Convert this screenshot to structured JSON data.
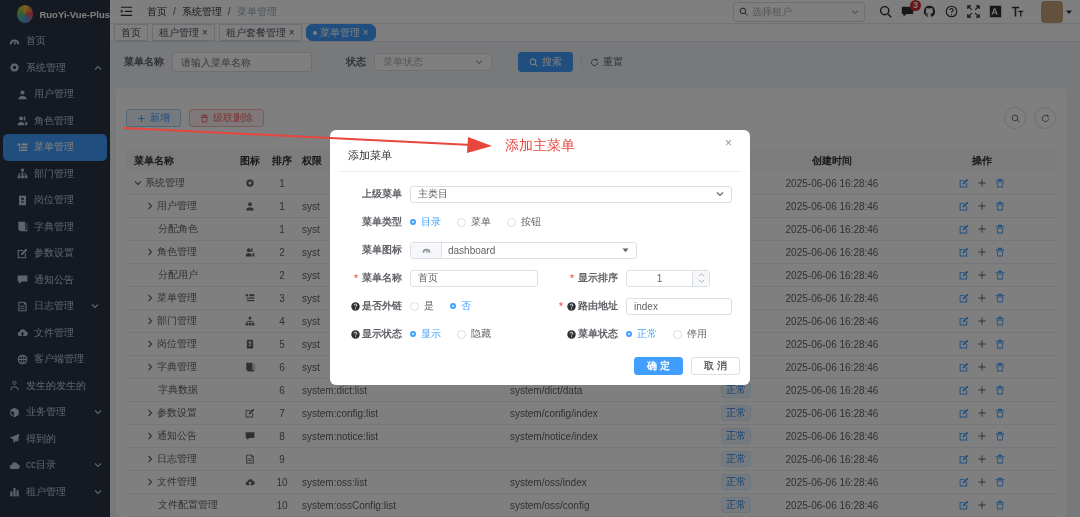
{
  "sidebar": {
    "logo_text": "RuoYi-Vue-Plus",
    "items": [
      {
        "label": "首页",
        "icon": {
          "kind": "dashboard"
        },
        "selected": false
      },
      {
        "label": "系统管理",
        "icon": {
          "kind": "gear"
        },
        "selected": false,
        "expanded": true,
        "children": [
          {
            "label": "用户管理",
            "icon": {
              "kind": "user"
            },
            "selected": false
          },
          {
            "label": "角色管理",
            "icon": {
              "kind": "users"
            },
            "selected": false
          },
          {
            "label": "菜单管理",
            "icon": {
              "kind": "menu"
            },
            "selected": true
          },
          {
            "label": "部门管理",
            "icon": {
              "kind": "tree"
            },
            "selected": false
          },
          {
            "label": "岗位管理",
            "icon": {
              "kind": "post"
            },
            "selected": false
          },
          {
            "label": "字典管理",
            "icon": {
              "kind": "dict"
            },
            "selected": false
          },
          {
            "label": "参数设置",
            "icon": {
              "kind": "edit"
            },
            "selected": false
          },
          {
            "label": "通知公告",
            "icon": {
              "kind": "message"
            },
            "selected": false
          },
          {
            "label": "日志管理",
            "icon": {
              "kind": "log"
            },
            "selected": false,
            "expanded": false
          },
          {
            "label": "文件管理",
            "icon": {
              "kind": "upload"
            },
            "selected": false
          },
          {
            "label": "客户端管理",
            "icon": {
              "kind": "client"
            },
            "selected": false
          }
        ]
      },
      {
        "label": "发生的发生的",
        "icon": {
          "kind": "person"
        },
        "selected": false
      },
      {
        "label": "业务管理",
        "icon": {
          "kind": "cube"
        },
        "selected": false,
        "expanded": false
      },
      {
        "label": "得到的",
        "icon": {
          "kind": "send"
        },
        "selected": false
      },
      {
        "label": "cc目录",
        "icon": {
          "kind": "cloud"
        },
        "selected": false,
        "expanded": false
      },
      {
        "label": "租户管理",
        "icon": {
          "kind": "chart"
        },
        "selected": false,
        "expanded": false
      }
    ]
  },
  "header": {
    "breadcrumb": [
      "首页",
      "系统管理",
      "菜单管理"
    ],
    "separator": "/",
    "tenant_select": {
      "placeholder": "选择租户"
    },
    "message_badge": "3"
  },
  "tabs": [
    {
      "label": "首页",
      "selected": false
    },
    {
      "label": "租户管理",
      "selected": false,
      "close": "×"
    },
    {
      "label": "租户套餐管理",
      "selected": false,
      "close": "×"
    },
    {
      "label": "菜单管理",
      "selected": true,
      "close": "×"
    }
  ],
  "search_form": {
    "name_label": "菜单名称",
    "name_placeholder": "请输入菜单名称",
    "status_label": "状态",
    "status_placeholder": "菜单状态",
    "search_button": "搜索",
    "reset_button": "重置"
  },
  "toolbar": {
    "buttons": [
      {
        "label": "新增",
        "kind": "primary"
      },
      {
        "label": "级联删除",
        "kind": "danger"
      }
    ]
  },
  "table": {
    "columns": [
      {
        "label": "菜单名称"
      },
      {
        "label": "图标"
      },
      {
        "label": "排序"
      },
      {
        "label": "权限"
      },
      {
        "label": "创建时间"
      },
      {
        "label": "操作"
      }
    ],
    "rows": [
      {
        "name": "系统管理",
        "kind": "folder",
        "expanded": true,
        "icon": {
          "kind": "gear"
        },
        "order": "1",
        "time": "2025-06-06 16:28:46",
        "children": [
          {
            "name": "用户管理",
            "kind": "folder",
            "expanded": false,
            "icon": {
              "kind": "user"
            },
            "order": "1",
            "perms": "syst",
            "time": "2025-06-06 16:28:46"
          },
          {
            "name": "分配角色",
            "kind": "leaf",
            "order": "1",
            "perms": "syst",
            "time": "2025-06-06 16:28:46"
          },
          {
            "name": "角色管理",
            "kind": "folder",
            "expanded": false,
            "icon": {
              "kind": "users"
            },
            "order": "2",
            "perms": "syst",
            "time": "2025-06-06 16:28:46"
          },
          {
            "name": "分配用户",
            "kind": "leaf",
            "order": "2",
            "perms": "syst",
            "time": "2025-06-06 16:28:46"
          },
          {
            "name": "菜单管理",
            "kind": "folder",
            "expanded": false,
            "icon": {
              "kind": "menu"
            },
            "order": "3",
            "perms": "syst",
            "time": "2025-06-06 16:28:46"
          },
          {
            "name": "部门管理",
            "kind": "folder",
            "expanded": false,
            "icon": {
              "kind": "tree"
            },
            "order": "4",
            "perms": "syst",
            "time": "2025-06-06 16:28:46"
          },
          {
            "name": "岗位管理",
            "kind": "folder",
            "expanded": false,
            "icon": {
              "kind": "post"
            },
            "order": "5",
            "perms": "syst",
            "time": "2025-06-06 16:28:46"
          },
          {
            "name": "字典管理",
            "kind": "folder",
            "expanded": false,
            "icon": {
              "kind": "dict"
            },
            "order": "6",
            "perms": "syst",
            "time": "2025-06-06 16:28:46"
          },
          {
            "name": "字典数据",
            "kind": "leaf",
            "order": "6",
            "perms": "system:dict:list",
            "path": "system/dict/data",
            "status": "正常",
            "time": "2025-06-06 16:28:46"
          },
          {
            "name": "参数设置",
            "kind": "folder",
            "expanded": false,
            "icon": {
              "kind": "edit"
            },
            "order": "7",
            "perms": "system:config:list",
            "path": "system/config/index",
            "status": "正常",
            "time": "2025-06-06 16:28:46"
          },
          {
            "name": "通知公告",
            "kind": "folder",
            "expanded": false,
            "icon": {
              "kind": "message"
            },
            "order": "8",
            "perms": "system:notice:list",
            "path": "system/notice/index",
            "status": "正常",
            "time": "2025-06-06 16:28:46"
          },
          {
            "name": "日志管理",
            "kind": "folder",
            "expanded": false,
            "icon": {
              "kind": "log"
            },
            "order": "9",
            "status": "正常",
            "time": "2025-06-06 16:28:46"
          },
          {
            "name": "文件管理",
            "kind": "folder",
            "expanded": false,
            "icon": {
              "kind": "upload"
            },
            "order": "10",
            "perms": "system:oss:list",
            "path": "system/oss/index",
            "status": "正常",
            "time": "2025-06-06 16:28:46"
          },
          {
            "name": "文件配置管理",
            "kind": "leaf",
            "order": "10",
            "perms": "system:ossConfig:list",
            "path": "system/oss/config",
            "status": "正常",
            "time": "2025-06-06 16:28:46"
          }
        ]
      }
    ]
  },
  "dialog": {
    "title": "添加菜单",
    "close": "×",
    "form": [
      [
        {
          "label": "上级菜单",
          "kind": "select",
          "value": "主类目",
          "help": false
        }
      ],
      [
        {
          "label": "菜单类型",
          "kind": "radio",
          "help": false,
          "options": [
            {
              "label": "目录",
              "selected": true
            },
            {
              "label": "菜单",
              "selected": false
            },
            {
              "label": "按钮",
              "selected": false
            }
          ]
        }
      ],
      [
        {
          "label": "菜单图标",
          "kind": "icon_select",
          "value": "dashboard",
          "help": false
        }
      ],
      [
        {
          "label": "菜单名称",
          "kind": "input",
          "value": "首页",
          "required_mark": "*",
          "help": false
        },
        {
          "label": "显示排序",
          "kind": "number",
          "value": "1",
          "required_mark": "*",
          "help": false
        }
      ],
      [
        {
          "label": "是否外链",
          "kind": "radio",
          "help": true,
          "options": [
            {
              "label": "是",
              "selected": false
            },
            {
              "label": "否",
              "selected": true
            }
          ]
        },
        {
          "label": "路由地址",
          "kind": "input",
          "value": "index",
          "required_mark": "*",
          "help": true
        }
      ],
      [
        {
          "label": "显示状态",
          "kind": "radio",
          "help": true,
          "options": [
            {
              "label": "显示",
              "selected": true
            },
            {
              "label": "隐藏",
              "selected": false
            }
          ]
        },
        {
          "label": "菜单状态",
          "kind": "radio",
          "help": true,
          "options": [
            {
              "label": "正常",
              "selected": true
            },
            {
              "label": "停用",
              "selected": false
            }
          ]
        }
      ]
    ],
    "buttons": [
      {
        "label": "确 定",
        "kind": "primary"
      },
      {
        "label": "取 消",
        "kind": "default"
      }
    ]
  },
  "annotation": {
    "text": "添加主菜单"
  }
}
